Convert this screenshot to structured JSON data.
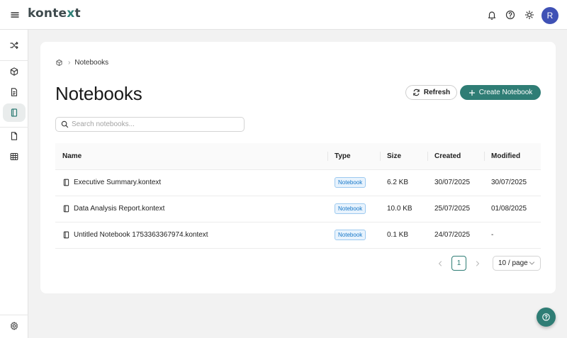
{
  "header": {
    "logo_main": "konte",
    "logo_accent": "x",
    "logo_end": "t",
    "avatar_initial": "R",
    "icons": [
      "menu-icon",
      "bell-icon",
      "help-circle-icon",
      "sun-icon"
    ]
  },
  "sidebar": {
    "items": [
      {
        "icon": "shuffle-icon"
      },
      {
        "icon": "cube-icon"
      },
      {
        "icon": "document-icon"
      },
      {
        "icon": "notebook-icon",
        "active": true
      },
      {
        "icon": "file-icon"
      },
      {
        "icon": "table-icon"
      },
      {
        "icon": "settings-icon"
      }
    ]
  },
  "breadcrumb": {
    "separator": "›",
    "current": "Notebooks"
  },
  "page": {
    "title": "Notebooks"
  },
  "actions": {
    "refresh_label": "Refresh",
    "create_label": "Create Notebook"
  },
  "search": {
    "placeholder": "Search notebooks...",
    "value": ""
  },
  "table": {
    "headers": [
      "Name",
      "Type",
      "Size",
      "Created",
      "Modified"
    ],
    "rows": [
      {
        "name": "Executive Summary.kontext",
        "type": "Notebook",
        "size": "6.2 KB",
        "created": "30/07/2025",
        "modified": "30/07/2025"
      },
      {
        "name": "Data Analysis Report.kontext",
        "type": "Notebook",
        "size": "10.0 KB",
        "created": "25/07/2025",
        "modified": "01/08/2025"
      },
      {
        "name": "Untitled Notebook 1753363367974.kontext",
        "type": "Notebook",
        "size": "0.1 KB",
        "created": "24/07/2025",
        "modified": "-"
      }
    ]
  },
  "pagination": {
    "current_page": "1",
    "page_size": "10 / page"
  },
  "colors": {
    "accent": "#2f7d75",
    "avatar": "#3f51b5",
    "tag_text": "#1677c8",
    "tag_bg": "#e8f3fd"
  }
}
